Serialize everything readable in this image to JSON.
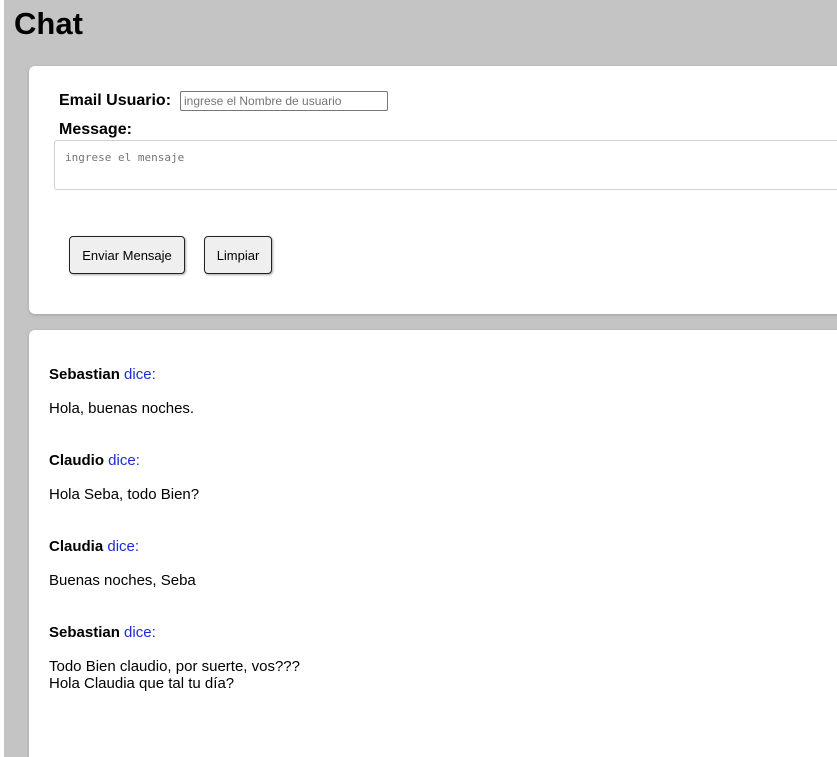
{
  "header": {
    "title": "Chat"
  },
  "form": {
    "email_label": "Email Usuario:",
    "email_placeholder": "ingrese el Nombre de usuario",
    "email_value": "",
    "message_label": "Message:",
    "message_placeholder": "ingrese el mensaje",
    "message_value": "",
    "send_label": "Enviar Mensaje",
    "clear_label": "Limpiar"
  },
  "messages": {
    "says_label": "dice:",
    "items": [
      {
        "author": "Sebastian",
        "text": "Hola, buenas noches."
      },
      {
        "author": "Claudio",
        "text": "Hola Seba, todo Bien?"
      },
      {
        "author": "Claudia",
        "text": "Buenas noches, Seba"
      },
      {
        "author": "Sebastian",
        "text": "Todo Bien claudio, por suerte, vos???\nHola Claudia que tal tu día?"
      }
    ]
  },
  "colors": {
    "background": "#c4c4c4",
    "card": "#ffffff",
    "says_accent": "#1f2bd1"
  }
}
